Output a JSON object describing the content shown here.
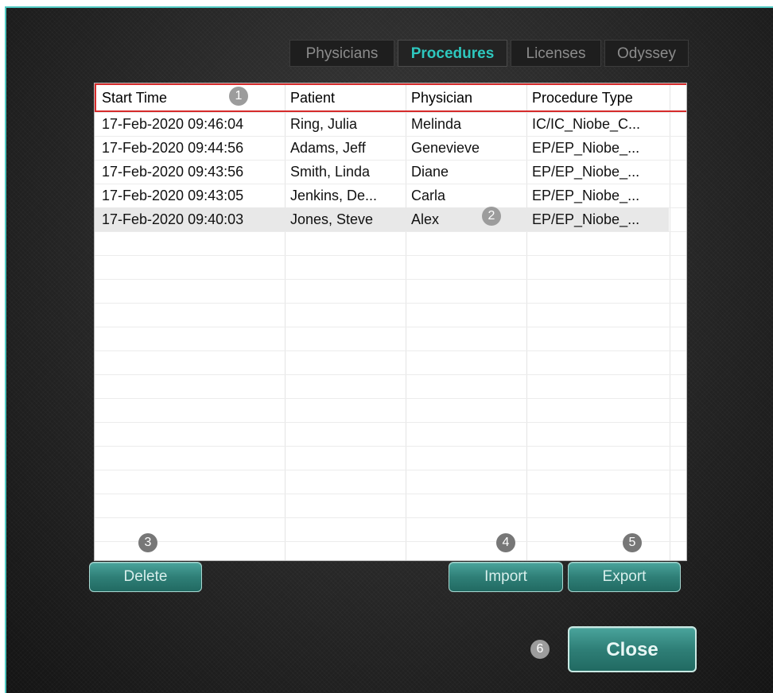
{
  "tabs": [
    {
      "label": "Physicians",
      "active": false
    },
    {
      "label": "Procedures",
      "active": true
    },
    {
      "label": "Licenses",
      "active": false
    },
    {
      "label": "Odyssey",
      "active": false
    }
  ],
  "table": {
    "columns": [
      "Start Time",
      "Patient",
      "Physician",
      "Procedure Type"
    ],
    "rows": [
      {
        "start_time": "17-Feb-2020 09:46:04",
        "patient": "Ring, Julia",
        "physician": "Melinda",
        "procedure_type": "IC/IC_Niobe_C..."
      },
      {
        "start_time": "17-Feb-2020 09:44:56",
        "patient": "Adams, Jeff",
        "physician": "Genevieve",
        "procedure_type": "EP/EP_Niobe_..."
      },
      {
        "start_time": "17-Feb-2020 09:43:56",
        "patient": "Smith, Linda",
        "physician": "Diane",
        "procedure_type": "EP/EP_Niobe_..."
      },
      {
        "start_time": "17-Feb-2020 09:43:05",
        "patient": "Jenkins, De...",
        "physician": "Carla",
        "procedure_type": "EP/EP_Niobe_..."
      },
      {
        "start_time": "17-Feb-2020 09:40:03",
        "patient": "Jones, Steve",
        "physician": "Alex",
        "procedure_type": "EP/EP_Niobe_...",
        "selected": true
      }
    ]
  },
  "buttons": {
    "delete": "Delete",
    "import": "Import",
    "export": "Export",
    "close": "Close"
  },
  "callouts": [
    "1",
    "2",
    "3",
    "4",
    "5",
    "6"
  ],
  "colors": {
    "accent": "#2ec8bf",
    "highlight_box": "#d62b2b",
    "button": "#2f7f77"
  }
}
